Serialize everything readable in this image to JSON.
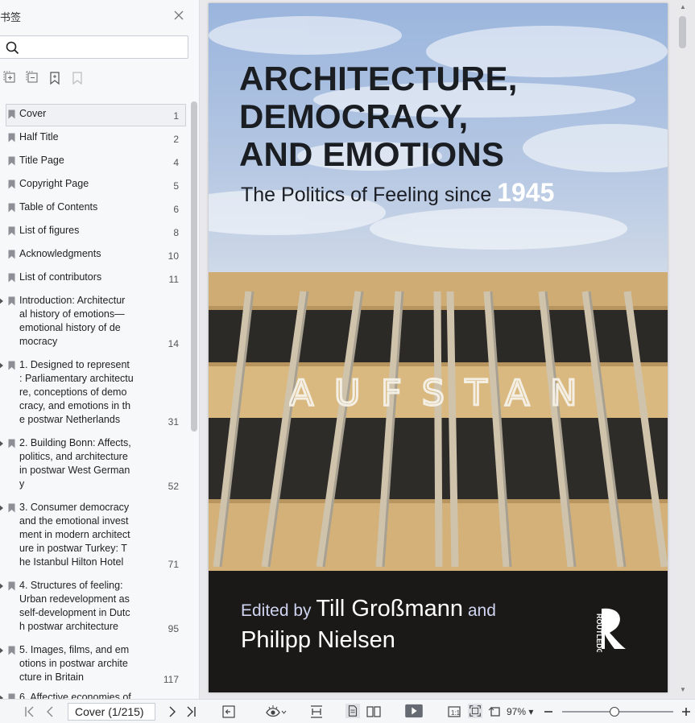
{
  "sidebar": {
    "title": "书签",
    "search": {
      "placeholder": "",
      "value": ""
    },
    "bookmarks": [
      {
        "label": "Cover",
        "page": "1"
      },
      {
        "label": "Half Title",
        "page": "2"
      },
      {
        "label": "Title Page",
        "page": "4"
      },
      {
        "label": "Copyright Page",
        "page": "5"
      },
      {
        "label": "Table of Contents",
        "page": "6"
      },
      {
        "label": "List of figures",
        "page": "8"
      },
      {
        "label": "Acknowledgments",
        "page": "10"
      },
      {
        "label": "List of contributors",
        "page": "11"
      },
      {
        "label": "Introduction: Architectural history of emotions—emotional history of democracy",
        "page": "14"
      },
      {
        "label": "1. Designed to represent: Parliamentary architecture, conceptions of democracy, and emotions in the postwar Netherlands",
        "page": "31"
      },
      {
        "label": "2. Building Bonn: Affects, politics, and architecture in postwar West Germany",
        "page": "52"
      },
      {
        "label": "3. Consumer democracy and the emotional investment in modern architecture in postwar Turkey: The Istanbul Hilton Hotel",
        "page": "71"
      },
      {
        "label": "4. Structures of feeling: Urban redevelopment as self-development in Dutch postwar architecture",
        "page": "95"
      },
      {
        "label": "5. Images, films, and emotions in postwar architecture in Britain",
        "page": "117"
      },
      {
        "label": "6. Affective economies of",
        "page": ""
      }
    ]
  },
  "cover": {
    "title_lines": [
      "ARCHITECTURE,",
      "DEMOCRACY,",
      "AND EMOTIONS"
    ],
    "subtitle": "The Politics of Feeling since ",
    "year": "1945",
    "graffiti": "AUFSTAN",
    "edited_by": "Edited by ",
    "editor1": "Till Großmann",
    "and": " and",
    "editor2": "Philipp Nielsen",
    "publisher": "ROUTLEDGE"
  },
  "toolbar": {
    "page_indicator": "Cover (1/215)",
    "zoom": "97%",
    "zoom_level": 0.47
  }
}
